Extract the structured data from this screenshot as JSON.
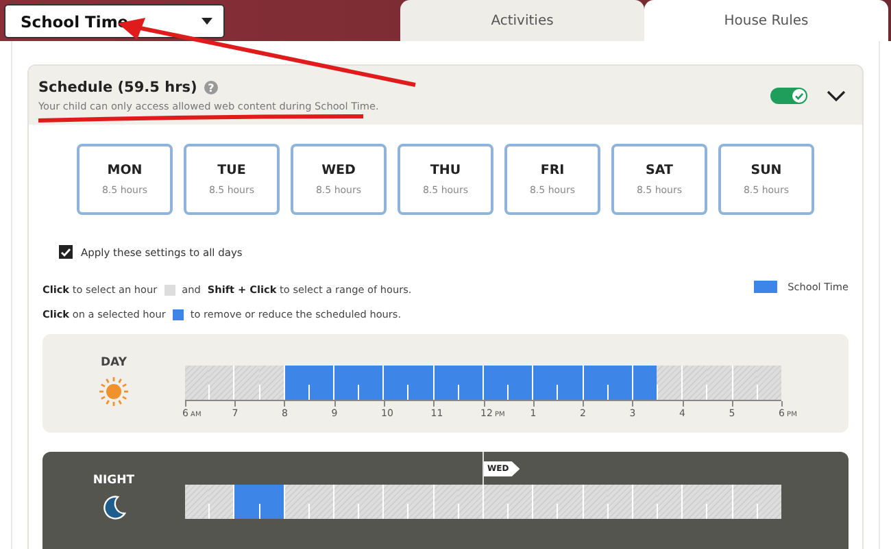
{
  "schedule_selector": {
    "value": "School Time"
  },
  "tabs": [
    {
      "label": "Activities",
      "selected": false
    },
    {
      "label": "House Rules",
      "selected": true
    }
  ],
  "schedule": {
    "title": "Schedule (59.5 hrs)",
    "help": "?",
    "description": "Your child can only access allowed web content during School Time.",
    "enabled": true,
    "expanded": true
  },
  "days": [
    {
      "label": "MON",
      "hours": "8.5 hours"
    },
    {
      "label": "TUE",
      "hours": "8.5 hours"
    },
    {
      "label": "WED",
      "hours": "8.5 hours"
    },
    {
      "label": "THU",
      "hours": "8.5 hours"
    },
    {
      "label": "FRI",
      "hours": "8.5 hours"
    },
    {
      "label": "SAT",
      "hours": "8.5 hours"
    },
    {
      "label": "SUN",
      "hours": "8.5 hours"
    }
  ],
  "apply_all": {
    "label": "Apply these settings to all days",
    "checked": true
  },
  "instructions": [
    [
      {
        "kind": "text",
        "text": "**Click** to select an hour"
      },
      {
        "kind": "swatch",
        "selected": false
      },
      {
        "kind": "text",
        "text": "and"
      },
      {
        "kind": "text",
        "text": "**Shift + Click** to select a range of hours."
      }
    ],
    [
      {
        "kind": "text",
        "text": "**Click** on a selected hour"
      },
      {
        "kind": "swatch",
        "selected": true
      },
      {
        "kind": "text",
        "text": "to remove or reduce the scheduled hours."
      }
    ]
  ],
  "legend": {
    "label": "School Time"
  },
  "day_timeline": {
    "label": "DAY",
    "slots": [
      {
        "selected": false
      },
      {
        "selected": false
      },
      {
        "selected": false
      },
      {
        "selected": false
      },
      {
        "selected": true
      },
      {
        "selected": true
      },
      {
        "selected": true
      },
      {
        "selected": true
      },
      {
        "selected": true
      },
      {
        "selected": true
      },
      {
        "selected": true
      },
      {
        "selected": true
      },
      {
        "selected": true
      },
      {
        "selected": true
      },
      {
        "selected": true
      },
      {
        "selected": true
      },
      {
        "selected": true
      },
      {
        "selected": true
      },
      {
        "selected": true
      },
      {
        "selected": false
      },
      {
        "selected": false
      },
      {
        "selected": false
      },
      {
        "selected": false
      },
      {
        "selected": false
      }
    ],
    "ticks": [
      {
        "label": "6",
        "suffix": "AM"
      },
      {
        "label": "7"
      },
      {
        "label": "8"
      },
      {
        "label": "9"
      },
      {
        "label": "10"
      },
      {
        "label": "11"
      },
      {
        "label": "12",
        "suffix": "PM"
      },
      {
        "label": "1"
      },
      {
        "label": "2"
      },
      {
        "label": "3"
      },
      {
        "label": "4"
      },
      {
        "label": "5"
      },
      {
        "label": "6",
        "suffix": "PM"
      }
    ]
  },
  "night_timeline": {
    "label": "NIGHT",
    "slots": [
      {
        "selected": false
      },
      {
        "selected": false
      },
      {
        "selected": true
      },
      {
        "selected": true
      },
      {
        "selected": false
      },
      {
        "selected": false
      },
      {
        "selected": false
      },
      {
        "selected": false
      },
      {
        "selected": false
      },
      {
        "selected": false
      },
      {
        "selected": false
      },
      {
        "selected": false
      },
      {
        "selected": false,
        "marker": "WED"
      },
      {
        "selected": false
      },
      {
        "selected": false
      },
      {
        "selected": false
      },
      {
        "selected": false
      },
      {
        "selected": false
      },
      {
        "selected": false
      },
      {
        "selected": false
      },
      {
        "selected": false
      },
      {
        "selected": false
      },
      {
        "selected": false
      },
      {
        "selected": false
      }
    ]
  }
}
